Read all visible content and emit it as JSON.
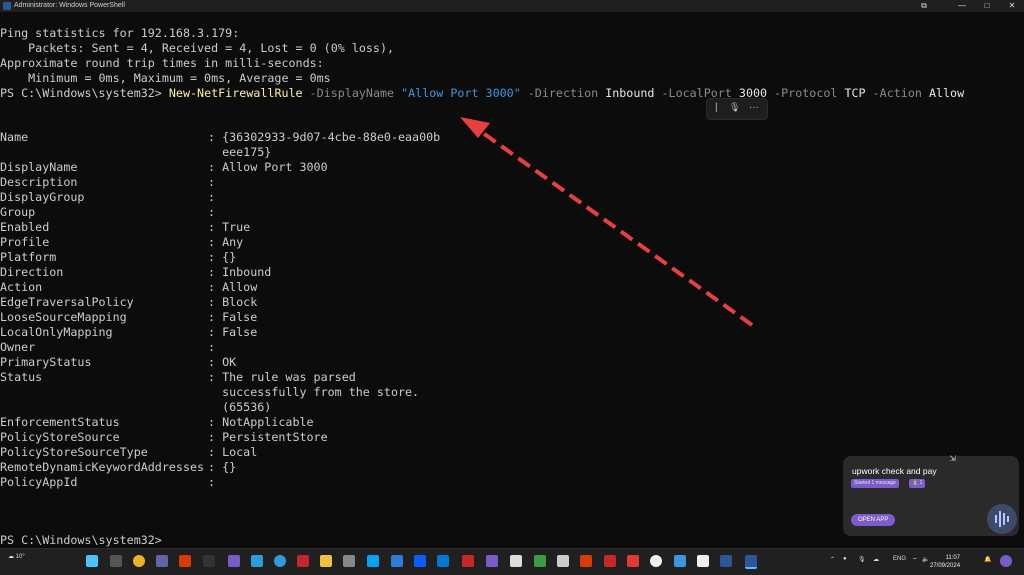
{
  "window": {
    "title": "Administrator: Windows PowerShell",
    "minimize_glyph": "—",
    "maximize_glyph": "□",
    "close_glyph": "✕",
    "pin_glyph": "⧉"
  },
  "terminal": {
    "ping_lines": [
      "Ping statistics for 192.168.3.179:",
      "    Packets: Sent = 4, Received = 4, Lost = 0 (0% loss),",
      "Approximate round trip times in milli-seconds:",
      "    Minimum = 0ms, Maximum = 0ms, Average = 0ms"
    ],
    "command": {
      "prompt": "PS C:\\Windows\\system32> ",
      "cmdlet": "New-NetFirewallRule",
      "p1": " -DisplayName ",
      "v1": "\"Allow Port 3000\"",
      "p2": " -Direction ",
      "v2": "Inbound",
      "p3": " -LocalPort ",
      "v3": "3000",
      "p4": " -Protocol ",
      "v4": "TCP",
      "p5": " -Action ",
      "v5": "Allow"
    },
    "properties": [
      {
        "name": "Name",
        "value": ": {36302933-9d07-4cbe-88e0-eaa00b"
      },
      {
        "name": "",
        "value": "  eee175}"
      },
      {
        "name": "DisplayName",
        "value": ": Allow Port 3000"
      },
      {
        "name": "Description",
        "value": ":"
      },
      {
        "name": "DisplayGroup",
        "value": ":"
      },
      {
        "name": "Group",
        "value": ":"
      },
      {
        "name": "Enabled",
        "value": ": True"
      },
      {
        "name": "Profile",
        "value": ": Any"
      },
      {
        "name": "Platform",
        "value": ": {}"
      },
      {
        "name": "Direction",
        "value": ": Inbound"
      },
      {
        "name": "Action",
        "value": ": Allow"
      },
      {
        "name": "EdgeTraversalPolicy",
        "value": ": Block"
      },
      {
        "name": "LooseSourceMapping",
        "value": ": False"
      },
      {
        "name": "LocalOnlyMapping",
        "value": ": False"
      },
      {
        "name": "Owner",
        "value": ":"
      },
      {
        "name": "PrimaryStatus",
        "value": ": OK"
      },
      {
        "name": "Status",
        "value": ": The rule was parsed"
      },
      {
        "name": "",
        "value": "  successfully from the store."
      },
      {
        "name": "",
        "value": "  (65536)"
      },
      {
        "name": "EnforcementStatus",
        "value": ": NotApplicable"
      },
      {
        "name": "PolicyStoreSource",
        "value": ": PersistentStore"
      },
      {
        "name": "PolicyStoreSourceType",
        "value": ": Local"
      },
      {
        "name": "RemoteDynamicKeywordAddresses",
        "value": ": {}"
      },
      {
        "name": "PolicyAppId",
        "value": ":"
      }
    ],
    "final_prompt": "PS C:\\Windows\\system32>"
  },
  "floating_toolbar": {
    "divider": "|",
    "mic_icon": "🎙",
    "more_icon": "···"
  },
  "notification": {
    "title": "upwork check and pay",
    "badge1": "Started 1 message",
    "badge2": "⏳ 1",
    "open_button": "OPEN APP"
  },
  "taskbar": {
    "weather_temp": "10°",
    "language": "ENG",
    "time": "11:07",
    "date": "27/09/2024",
    "colors": {
      "windows": "#4cc2ff",
      "chrome": "#e8b52a",
      "edge": "#2d9cdb",
      "red": "#d83b01",
      "purple": "#7a5cc8",
      "green": "#3b9b46",
      "powershell": "#2b5797"
    }
  },
  "annotation": {
    "arrow_color": "#e84040"
  }
}
